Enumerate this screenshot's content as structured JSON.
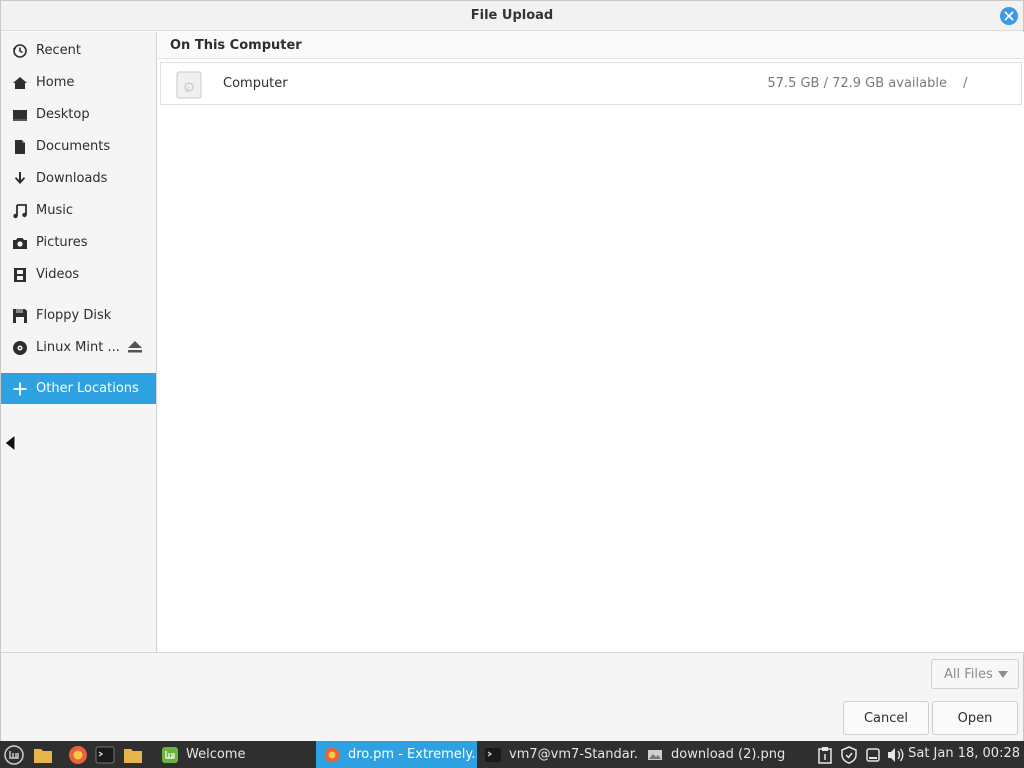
{
  "window": {
    "title": "File Upload",
    "close_icon": "close-icon"
  },
  "sidebar": {
    "items": [
      {
        "label": "Recent",
        "icon": "clock-icon"
      },
      {
        "label": "Home",
        "icon": "home-icon"
      },
      {
        "label": "Desktop",
        "icon": "desktop-icon"
      },
      {
        "label": "Documents",
        "icon": "document-icon"
      },
      {
        "label": "Downloads",
        "icon": "download-icon"
      },
      {
        "label": "Music",
        "icon": "music-icon"
      },
      {
        "label": "Pictures",
        "icon": "camera-icon"
      },
      {
        "label": "Videos",
        "icon": "film-icon"
      },
      {
        "label": "Floppy Disk",
        "icon": "floppy-icon"
      },
      {
        "label": "Linux Mint ...",
        "icon": "disc-icon",
        "eject": true
      },
      {
        "label": "Other Locations",
        "icon": "plus-icon",
        "active": true
      }
    ]
  },
  "main": {
    "section_header": "On This Computer",
    "locations": [
      {
        "name": "Computer",
        "space": "57.5 GB / 72.9 GB available",
        "path": "/",
        "icon": "drive-icon"
      }
    ]
  },
  "bottom": {
    "filter_value": "All Files",
    "cancel_label": "Cancel",
    "open_label": "Open"
  },
  "taskbar": {
    "windows": [
      {
        "label": "Welcome",
        "icon": "mint-welcome-icon"
      },
      {
        "label": "dro.pm - Extremely...",
        "icon": "firefox-icon",
        "active": true
      },
      {
        "label": "vm7@vm7-Standar...",
        "icon": "terminal-icon"
      },
      {
        "label": "download (2).png",
        "icon": "image-viewer-icon"
      }
    ],
    "clock": "Sat Jan 18, 00:28"
  },
  "colors": {
    "accent": "#2ea2e0",
    "taskbar_bg": "#2f2f2f",
    "close_button": "#3a9ae6"
  }
}
